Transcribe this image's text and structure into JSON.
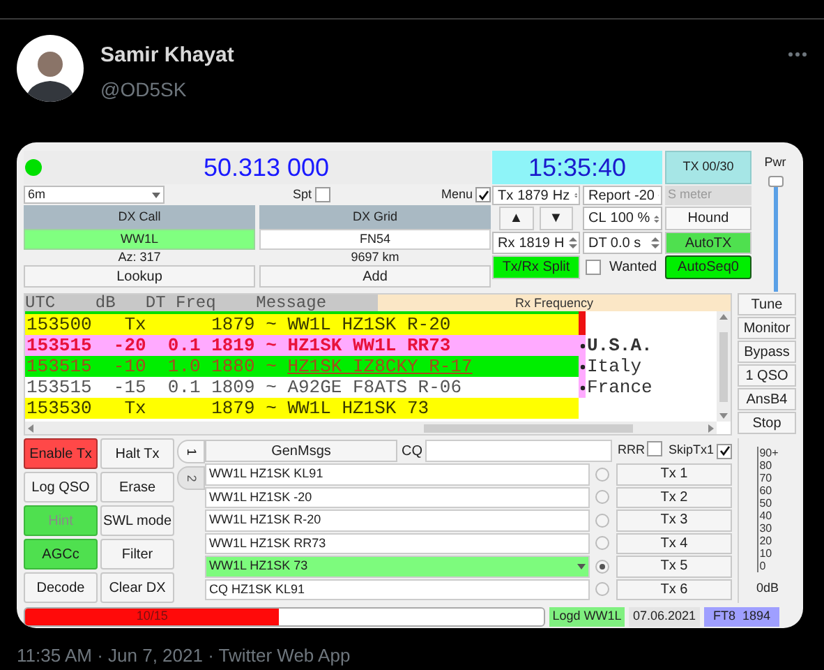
{
  "tweet": {
    "author": "Samir Khayat",
    "handle": "@OD5SK",
    "timestamp": "11:35 AM · Jun 7, 2021 · Twitter Web App"
  },
  "app": {
    "frequency": "50.313 000",
    "clock": "15:35:40",
    "tx_counter": "TX 00/30",
    "band": "6m",
    "spot": {
      "label": "Spt",
      "checked": false
    },
    "menu": {
      "label": "Menu",
      "checked": true
    },
    "tx_freq": {
      "label": "Tx",
      "value": "1879",
      "unit": "Hz"
    },
    "report": {
      "label": "Report",
      "value": "-20"
    },
    "s_meter": "S meter",
    "dx_call": {
      "label": "DX Call",
      "value": "WW1L"
    },
    "dx_grid": {
      "label": "DX Grid",
      "value": "FN54"
    },
    "azimuth": "Az: 317",
    "distance": "9697 km",
    "lookup_button": "Lookup",
    "add_button": "Add",
    "arrow_buttons": [
      "▲",
      "▼"
    ],
    "cl": {
      "label": "CL",
      "value": "100 %"
    },
    "rx_freq": {
      "label": "Rx",
      "value": "1819",
      "unit": "H"
    },
    "dt": "DT 0.0 s",
    "mode_buttons": [
      {
        "label": "Hound",
        "on": false
      },
      {
        "label": "AutoTX",
        "on": true
      },
      {
        "label": "AutoSeq0",
        "on": true
      }
    ],
    "split": {
      "label": "Tx/Rx Split",
      "on": true
    },
    "wanted": {
      "label": "Wanted",
      "checked": false
    },
    "power": {
      "label": "Pwr",
      "level": 1
    },
    "decode_header": "UTC    dB   DT Freq    Message",
    "rx_frequency_header": "Rx Frequency",
    "decodes": [
      {
        "kind": "tx",
        "utc": "153500",
        "db": "Tx",
        "freq": "1879",
        "mode": "~",
        "message": "WW1L HZ1SK R-20"
      },
      {
        "kind": "to_me",
        "utc": "153515",
        "db": "-20",
        "dt": "0.1",
        "freq": "1819",
        "mode": "~",
        "message": "HZ1SK WW1L RR73",
        "country": "U.S.A."
      },
      {
        "kind": "new",
        "utc": "153515",
        "db": "-10",
        "dt": "1.0",
        "freq": "1880",
        "mode": "~",
        "message": "HZ1SK IZ8CKY R-17",
        "country": "Italy"
      },
      {
        "kind": "plain",
        "utc": "153515",
        "db": "-15",
        "dt": "0.1",
        "freq": "1809",
        "mode": "~",
        "message": "A92GE F8ATS R-06",
        "country": "France"
      },
      {
        "kind": "tx",
        "utc": "153530",
        "db": "Tx",
        "freq": "1879",
        "mode": "~",
        "message": "WW1L HZ1SK 73"
      }
    ],
    "side_buttons": [
      "Tune",
      "Monitor",
      "Bypass",
      "1 QSO",
      "AnsB4",
      "Stop"
    ],
    "control_buttons": [
      {
        "label": "Enable Tx",
        "kind": "alert",
        "disabled": false
      },
      {
        "label": "Halt Tx",
        "kind": "normal",
        "disabled": false
      },
      {
        "label": "Log QSO",
        "kind": "normal",
        "disabled": false
      },
      {
        "label": "Erase",
        "kind": "normal",
        "disabled": false
      },
      {
        "label": "Hint",
        "kind": "active",
        "disabled": true
      },
      {
        "label": "SWL mode",
        "kind": "normal",
        "disabled": false
      },
      {
        "label": "AGCc",
        "kind": "active",
        "disabled": false
      },
      {
        "label": "Filter",
        "kind": "normal",
        "disabled": false
      },
      {
        "label": "Decode",
        "kind": "normal",
        "disabled": false
      },
      {
        "label": "Clear DX",
        "kind": "normal",
        "disabled": false
      }
    ],
    "message_tabs": [
      {
        "label": "1",
        "selected": true
      },
      {
        "label": "2",
        "selected": false
      }
    ],
    "genmsgs_button": "GenMsgs",
    "cq": {
      "label": "CQ"
    },
    "rrr": {
      "label": "RRR",
      "checked": false
    },
    "skip_tx1": {
      "label": "SkipTx1",
      "checked": true
    },
    "messages": [
      {
        "text": "WW1L HZ1SK KL91",
        "button": "Tx 1",
        "selected": false
      },
      {
        "text": "WW1L HZ1SK -20",
        "button": "Tx 2",
        "selected": false
      },
      {
        "text": "WW1L HZ1SK R-20",
        "button": "Tx 3",
        "selected": false
      },
      {
        "text": "WW1L HZ1SK RR73",
        "button": "Tx 4",
        "selected": false
      },
      {
        "text": "WW1L HZ1SK 73",
        "button": "Tx 5",
        "selected": true
      },
      {
        "text": "CQ HZ1SK KL91",
        "button": "Tx 6",
        "selected": false
      }
    ],
    "meter_scale": [
      "90+",
      "80",
      "70",
      "60",
      "50",
      "40",
      "30",
      "20",
      "10",
      "0"
    ],
    "meter_reading": "0dB",
    "status_bar": {
      "progress": {
        "text": "10/15",
        "level": 0.49
      },
      "logged": "Logd WW1L",
      "date": "07.06.2021",
      "mode": "FT8  1894"
    }
  }
}
